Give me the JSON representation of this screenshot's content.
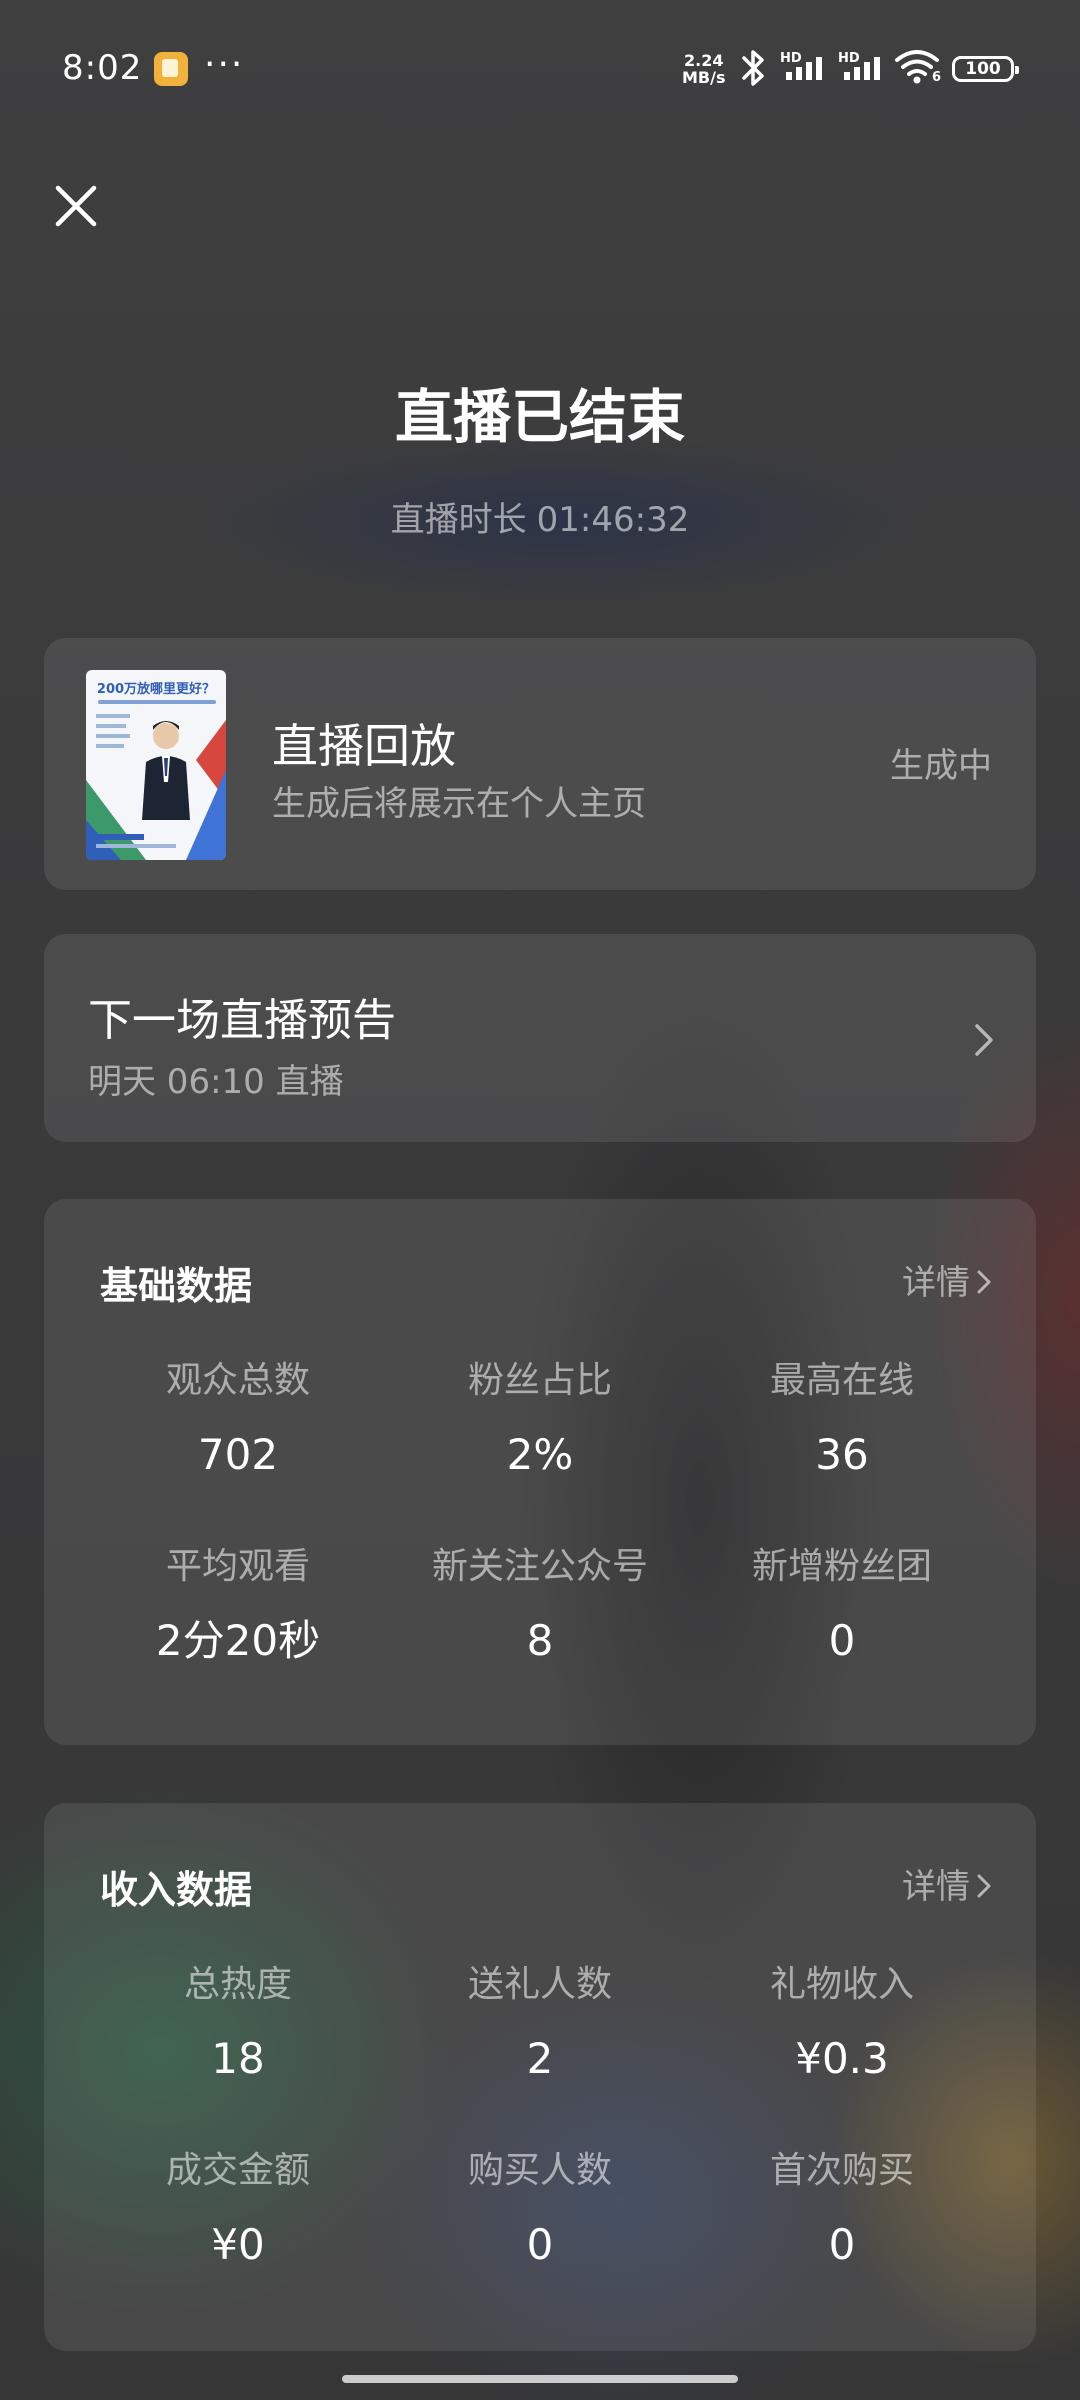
{
  "status_bar": {
    "time": "8:02",
    "more": "···",
    "net_speed_value": "2.24",
    "net_speed_unit": "MB/s",
    "signal1_label": "HD",
    "signal2_label": "HD",
    "wifi_label": "6",
    "battery": "100"
  },
  "header": {
    "title": "直播已结束",
    "duration_label": "直播时长",
    "duration_value": "01:46:32"
  },
  "replay": {
    "title": "直播回放",
    "subtitle": "生成后将展示在个人主页",
    "status": "生成中",
    "thumbnail_title": "200万放哪里更好？"
  },
  "next_live": {
    "title": "下一场直播预告",
    "subtitle": "明天 06:10 直播"
  },
  "basic_data": {
    "title": "基础数据",
    "details": "详情",
    "items": [
      {
        "label": "观众总数",
        "value": "702"
      },
      {
        "label": "粉丝占比",
        "value": "2%"
      },
      {
        "label": "最高在线",
        "value": "36"
      },
      {
        "label": "平均观看",
        "value": "2分20秒"
      },
      {
        "label": "新关注公众号",
        "value": "8"
      },
      {
        "label": "新增粉丝团",
        "value": "0"
      }
    ]
  },
  "income_data": {
    "title": "收入数据",
    "details": "详情",
    "items": [
      {
        "label": "总热度",
        "value": "18"
      },
      {
        "label": "送礼人数",
        "value": "2"
      },
      {
        "label": "礼物收入",
        "value": "¥0.3"
      },
      {
        "label": "成交金额",
        "value": "¥0"
      },
      {
        "label": "购买人数",
        "value": "0"
      },
      {
        "label": "首次购买",
        "value": "0"
      }
    ]
  },
  "colors": {
    "background": "#3a3a3b",
    "card": "rgba(255,255,255,0.09)",
    "secondary_text": "rgba(255,255,255,0.55)",
    "accent_thumbnail": "#2f5fb8"
  }
}
